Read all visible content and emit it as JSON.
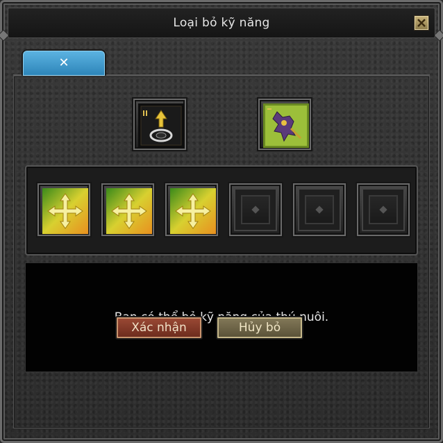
{
  "window": {
    "title": "Loại bỏ kỹ năng",
    "close_icon": "close-icon"
  },
  "tabs": [
    {
      "label": "✕",
      "active": true
    }
  ],
  "pet_slots": [
    {
      "icon": "pet-summon-icon"
    },
    {
      "icon": "pet-creature-icon"
    }
  ],
  "skill_slots": [
    {
      "icon": "skill-arrows-icon",
      "filled": true
    },
    {
      "icon": "skill-arrows-icon",
      "filled": true
    },
    {
      "icon": "skill-arrows-icon",
      "filled": true
    },
    {
      "icon": "empty-slot-icon",
      "filled": false
    },
    {
      "icon": "empty-slot-icon",
      "filled": false
    },
    {
      "icon": "empty-slot-icon",
      "filled": false
    }
  ],
  "message": "Bạn có thể bỏ kỹ năng của thú nuôi.",
  "buttons": {
    "confirm_label": "Xác nhận",
    "cancel_label": "Hủy bỏ"
  },
  "colors": {
    "tab_active": "#3c9ad0",
    "confirm_button": "#8a3a28",
    "cancel_button": "#74694a"
  }
}
